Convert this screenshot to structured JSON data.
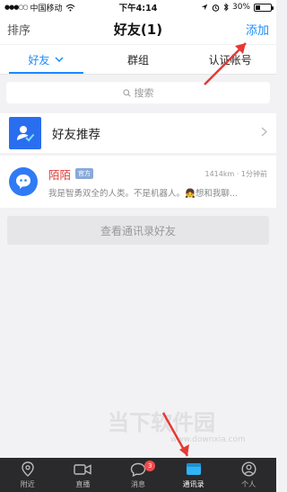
{
  "status_bar": {
    "carrier": "中国移动",
    "time": "下午4:14",
    "battery": "30%",
    "battery_level": 0.3
  },
  "nav": {
    "left": "排序",
    "title": "好友(1)",
    "right": "添加"
  },
  "tabs": [
    {
      "label": "好友",
      "active": true
    },
    {
      "label": "群组",
      "active": false
    },
    {
      "label": "认证帐号",
      "active": false
    }
  ],
  "search": {
    "placeholder": "搜索"
  },
  "recommend": {
    "label": "好友推荐"
  },
  "contact": {
    "name": "陌陌",
    "badge": "官方",
    "meta": "1414km · 1分钟前",
    "desc": "我是智勇双全的人类。不是机器人。👧想和我聊..."
  },
  "view_all": {
    "label": "查看通讯录好友"
  },
  "bottom_bar": {
    "items": [
      {
        "label": "附近",
        "icon": "location-pin-icon"
      },
      {
        "label": "直播",
        "icon": "video-camera-icon"
      },
      {
        "label": "消息",
        "icon": "message-icon",
        "badge": "3"
      },
      {
        "label": "通讯录",
        "icon": "contacts-icon",
        "active": true
      },
      {
        "label": "个人",
        "icon": "person-icon"
      }
    ]
  },
  "watermark": {
    "text": "当下软件园",
    "url": "www.downxia.com"
  },
  "colors": {
    "accent": "#1a8cff",
    "recommend_bg": "#2a6ef0",
    "name_red": "#e03a3a",
    "bottom_bar": "#2a2a2c",
    "annotation_red": "#e53935"
  }
}
